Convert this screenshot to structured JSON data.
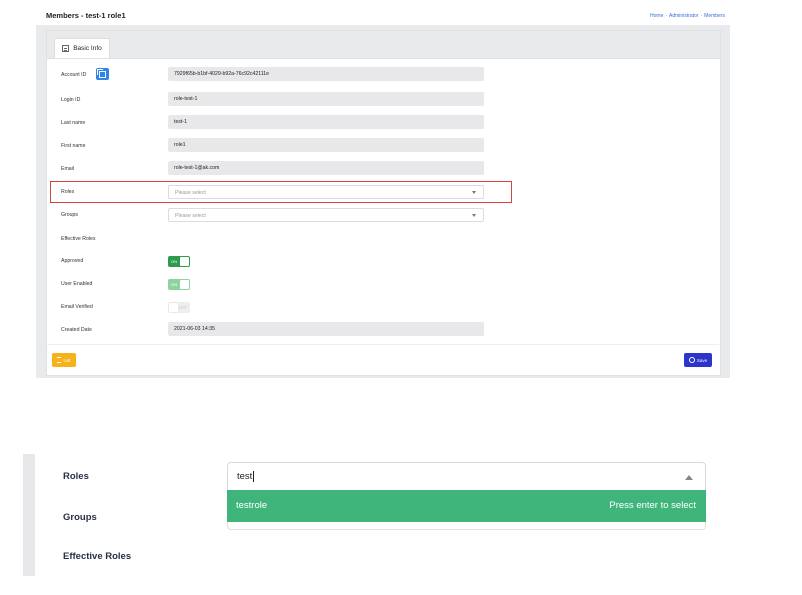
{
  "header": {
    "title": "Members - test-1 role1",
    "breadcrumb": [
      "Home",
      "Administrator",
      "Members"
    ],
    "breadcrumb_sep": "·"
  },
  "tabs": [
    {
      "label": "Basic Info",
      "icon": "form-icon"
    }
  ],
  "form": {
    "account_id_label": "Account ID",
    "account_id_value": "7929f65b-b1bf-4029-b92a-76c92c42111e",
    "login_id_label": "Login ID",
    "login_id_value": "role-test-1",
    "last_name_label": "Last name",
    "last_name_value": "test-1",
    "first_name_label": "First name",
    "first_name_value": "role1",
    "email_label": "Email",
    "email_value": "role-test-1@ak.com",
    "roles_label": "Roles",
    "roles_placeholder": "Please select",
    "groups_label": "Groups",
    "groups_placeholder": "Please select",
    "effective_roles_label": "Effective Roles",
    "approved_label": "Approved",
    "approved_state": "ON",
    "user_enabled_label": "User Enabled",
    "user_enabled_state": "ON",
    "email_verified_label": "Email Verified",
    "email_verified_state": "OFF",
    "created_date_label": "Created Date",
    "created_date_value": "2021-06-03 14:35"
  },
  "footer": {
    "list_label": "List",
    "save_label": "Save"
  },
  "zoom": {
    "roles_label": "Roles",
    "groups_label": "Groups",
    "effective_roles_label": "Effective Roles",
    "input_value": "test",
    "option_label": "testrole",
    "option_hint": "Press enter to select"
  },
  "colors": {
    "highlight": "#d64545",
    "toggle_on": "#2e9c4d",
    "option_bg": "#3fb57c",
    "save": "#2d34c9",
    "list": "#f5b21a",
    "copy": "#2f86e8"
  }
}
